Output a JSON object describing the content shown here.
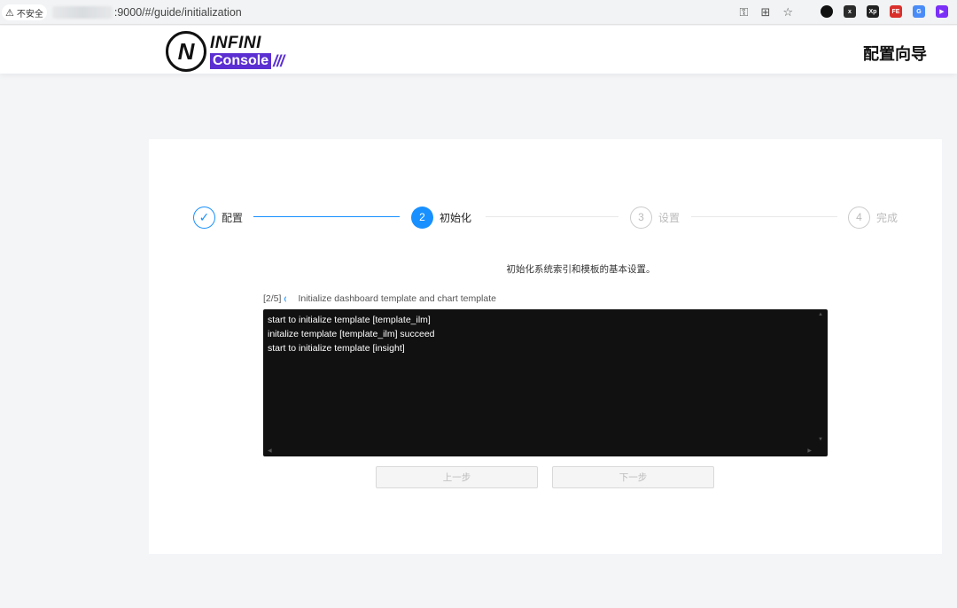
{
  "browser": {
    "security_label": "不安全",
    "url": ":9000/#/guide/initialization"
  },
  "header": {
    "logo_top": "INFINI",
    "logo_bottom": "Console",
    "logo_slashes": "///",
    "title": "配置向导"
  },
  "steps": [
    {
      "index": "✓",
      "label": "配置",
      "status": "done"
    },
    {
      "index": "2",
      "label": "初始化",
      "status": "active"
    },
    {
      "index": "3",
      "label": "设置",
      "status": "wait"
    },
    {
      "index": "4",
      "label": "完成",
      "status": "wait"
    }
  ],
  "main": {
    "description": "初始化系统索引和模板的基本设置。",
    "progress_counter": "[2/5]",
    "progress_text": "Initialize dashboard template and chart template",
    "console_lines": [
      "start to initialize template [template_ilm]",
      "initalize template [template_ilm] succeed",
      "start to initialize template [insight]"
    ],
    "prev_label": "上一步",
    "next_label": "下一步"
  },
  "colors": {
    "primary": "#1890ff",
    "brand_purple": "#5b2fd1",
    "console_bg": "#111111"
  }
}
